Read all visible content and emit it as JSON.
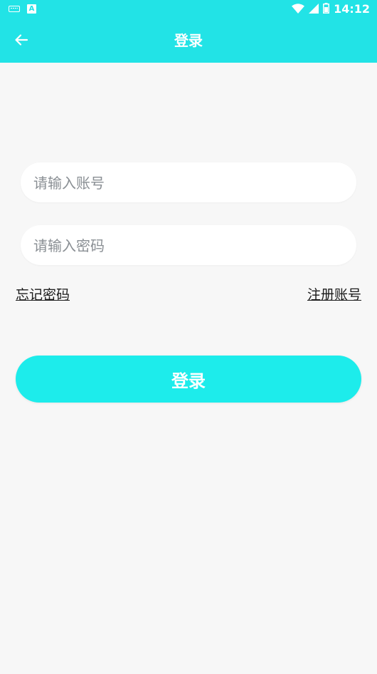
{
  "status_bar": {
    "time": "14:12",
    "left_icons": [
      "keyboard-icon",
      "a-app-icon"
    ],
    "right_icons": [
      "wifi-icon",
      "cellular-signal-icon",
      "battery-icon"
    ]
  },
  "toolbar": {
    "title": "登录",
    "back_icon": "arrow-left-icon"
  },
  "form": {
    "account_placeholder": "请输入账号",
    "account_value": "",
    "password_placeholder": "请输入密码",
    "password_value": "",
    "forgot_password_label": "忘记密码",
    "register_label": "注册账号",
    "login_label": "登录"
  },
  "colors": {
    "primary": "#22e3e6",
    "button": "#1deceb",
    "background": "#f7f7f7",
    "input_background": "#ffffff",
    "link_text": "#1a1a1a"
  }
}
